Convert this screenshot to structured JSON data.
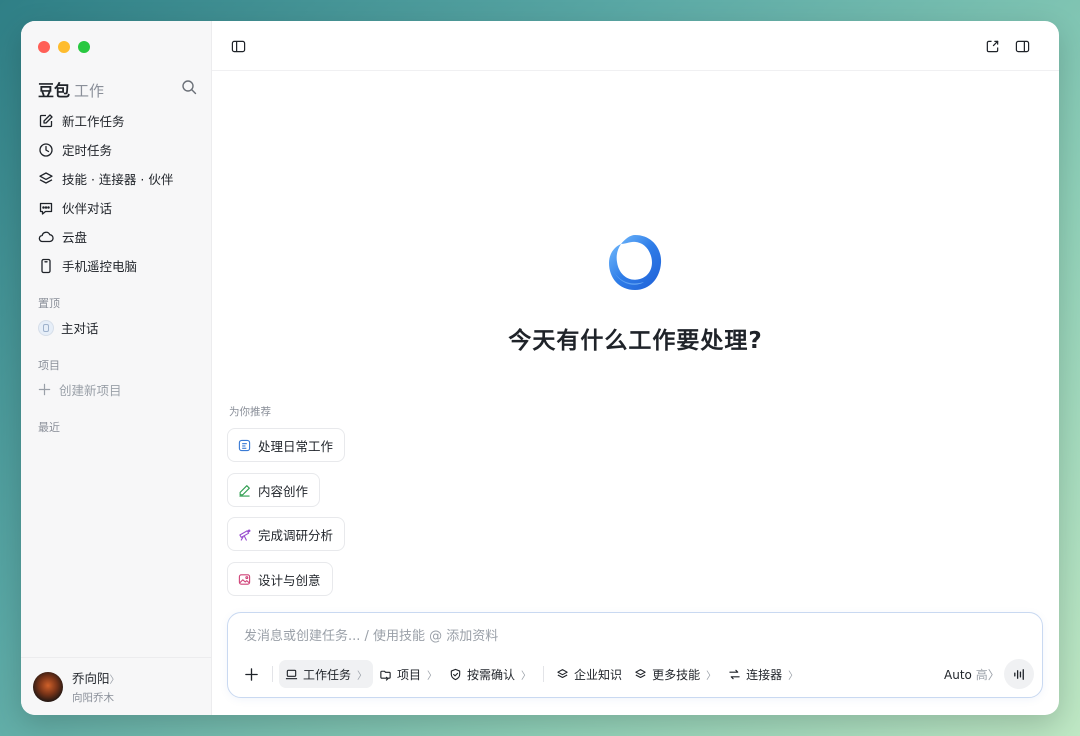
{
  "sidebar": {
    "brand": "豆包",
    "brand_sub": "工作",
    "nav": [
      {
        "label": "新工作任务",
        "icon": "edit-icon"
      },
      {
        "label": "定时任务",
        "icon": "clock-icon"
      },
      {
        "label": "技能 · 连接器 · 伙伴",
        "icon": "layers-icon"
      },
      {
        "label": "伙伴对话",
        "icon": "chat-icon"
      },
      {
        "label": "云盘",
        "icon": "cloud-icon"
      },
      {
        "label": "手机遥控电脑",
        "icon": "phone-icon"
      }
    ],
    "pinned_label": "置顶",
    "pinned_item": "主对话",
    "projects_label": "项目",
    "new_project": "创建新项目",
    "recent_label": "最近"
  },
  "user": {
    "name": "乔向阳",
    "handle": "向阳乔木",
    "chevron": "〉"
  },
  "main": {
    "headline": "今天有什么工作要处理?",
    "recommend_label": "为你推荐",
    "recommendations": [
      {
        "label": "处理日常工作",
        "icon": "list-icon",
        "color": "#3a7bd5"
      },
      {
        "label": "内容创作",
        "icon": "pen-icon",
        "color": "#2e9d4f"
      },
      {
        "label": "完成调研分析",
        "icon": "telescope-icon",
        "color": "#9a4fd0"
      },
      {
        "label": "设计与创意",
        "icon": "image-icon",
        "color": "#d0457a"
      }
    ]
  },
  "composer": {
    "placeholder": "发消息或创建任务... / 使用技能 @ 添加资料",
    "tools": [
      {
        "label": "工作任务",
        "chevron": "〉"
      },
      {
        "label": "项目",
        "chevron": "〉"
      },
      {
        "label": "按需确认",
        "chevron": "〉"
      },
      {
        "label": "企业知识",
        "chevron": ""
      },
      {
        "label": "更多技能",
        "chevron": "〉"
      },
      {
        "label": "连接器",
        "chevron": "〉"
      }
    ],
    "model": "Auto",
    "level": "高",
    "chevron": "〉"
  },
  "colors": {
    "accent": "#3a7bd5",
    "sidebar_bg": "#f7f7f8",
    "composer_border": "#c9d9f1"
  }
}
